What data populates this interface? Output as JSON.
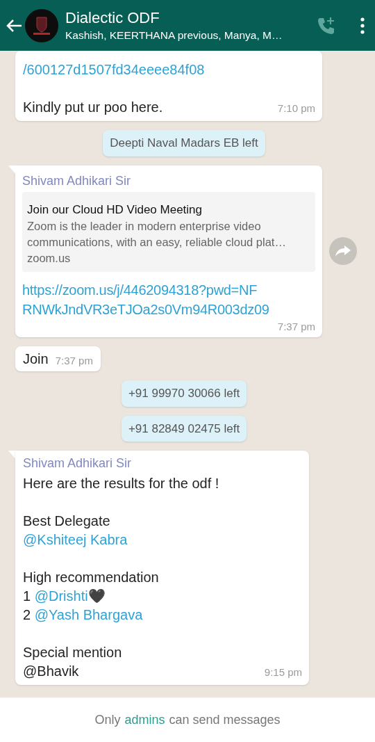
{
  "header": {
    "title": "Dialectic ODF",
    "subtitle": "Kashish, KEERTHANA previous, Manya, M…"
  },
  "messages": [
    {
      "kind": "text",
      "tail": false,
      "paragraphs": [
        [
          [
            {
              "text": "/600127d1507fd34eeee84f08",
              "link": true
            }
          ]
        ],
        [
          [
            {
              "text": "Kindly put ur poo here.",
              "link": false
            }
          ]
        ]
      ],
      "time": "7:10 pm"
    },
    {
      "kind": "notice",
      "text": "Deepti Naval Madars EB left"
    },
    {
      "kind": "link_preview",
      "tail": true,
      "sender": "Shivam Adhikari Sir",
      "preview": {
        "title": "Join our Cloud HD Video Meeting",
        "description": "Zoom is the leader in modern enterprise video communications, with an easy, reliable cloud plat…",
        "domain": "zoom.us"
      },
      "link_lines": [
        "https://zoom.us/j/4462094318?pwd=NF",
        "RNWkJndVR3eTJOa2s0Vm94R003dz09"
      ],
      "time": "7:37 pm",
      "forward": true
    },
    {
      "kind": "short",
      "text": "Join",
      "time": "7:37 pm"
    },
    {
      "kind": "notice",
      "text": "+91 99970 30066 left"
    },
    {
      "kind": "notice",
      "text": "+91 82849 02475 left"
    },
    {
      "kind": "text",
      "tail": true,
      "sender": "Shivam Adhikari Sir",
      "paragraphs": [
        [
          [
            {
              "text": "Here are the results for the odf !",
              "link": false
            }
          ]
        ],
        [
          [
            {
              "text": "Best Delegate",
              "link": false
            }
          ],
          [
            {
              "text": "@Kshiteej Kabra",
              "link": true
            }
          ]
        ],
        [
          [
            {
              "text": "High recommendation",
              "link": false
            }
          ],
          [
            {
              "text": "1 ",
              "link": false
            },
            {
              "text": "@Drishti",
              "link": true
            },
            {
              "text": "🖤"
            }
          ],
          [
            {
              "text": "2 ",
              "link": false
            },
            {
              "text": "@Yash Bhargava",
              "link": true
            }
          ]
        ],
        [
          [
            {
              "text": "Special mention",
              "link": false
            }
          ],
          [
            {
              "text": "@Bhavik",
              "link": false
            }
          ]
        ]
      ],
      "time": "9:15 pm"
    }
  ],
  "footer": {
    "parts": [
      {
        "text": "Only",
        "link": false
      },
      {
        "text": "admins",
        "link": true
      },
      {
        "text": "can send messages",
        "link": false
      }
    ]
  }
}
